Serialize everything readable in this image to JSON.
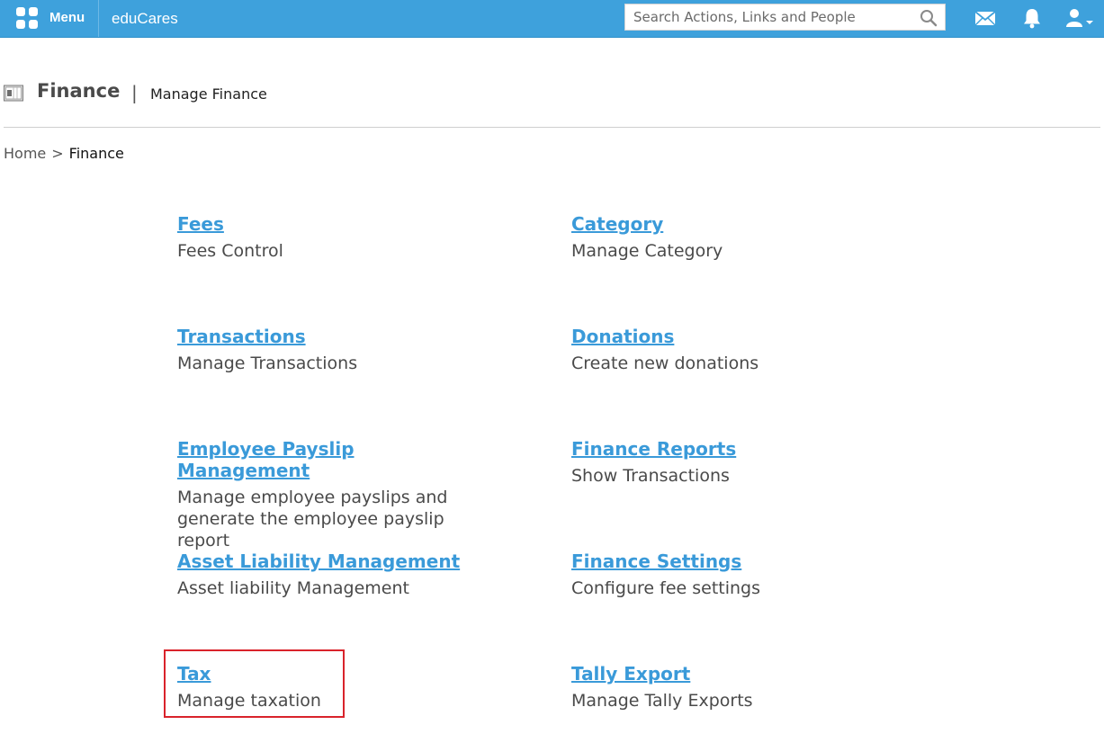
{
  "topbar": {
    "menu_label": "Menu",
    "brand": "eduCares",
    "search_placeholder": "Search Actions, Links and People",
    "accent_color": "#3ea1dc",
    "icons": [
      "menu-grid-icon",
      "search-icon",
      "mail-icon",
      "bell-icon",
      "user-icon"
    ]
  },
  "header": {
    "title": "Finance",
    "separator": "|",
    "subtitle": "Manage Finance"
  },
  "breadcrumb": {
    "home": "Home",
    "separator": ">",
    "current": "Finance"
  },
  "modules": [
    {
      "title": "Fees",
      "description": "Fees Control"
    },
    {
      "title": "Category",
      "description": "Manage Category"
    },
    {
      "title": "Transactions",
      "description": "Manage Transactions"
    },
    {
      "title": "Donations",
      "description": "Create new donations"
    },
    {
      "title": "Employee Payslip Management",
      "description": "Manage employee payslips and generate the employee payslip report"
    },
    {
      "title": "Finance Reports",
      "description": "Show Transactions"
    },
    {
      "title": "Asset Liability Management",
      "description": "Asset liability Management"
    },
    {
      "title": "Finance Settings",
      "description": "Configure fee settings"
    },
    {
      "title": "Tax",
      "description": "Manage taxation"
    },
    {
      "title": "Tally Export",
      "description": "Manage Tally Exports"
    }
  ],
  "colors": {
    "link": "#3a9ad9",
    "highlight": "#d9232b"
  }
}
